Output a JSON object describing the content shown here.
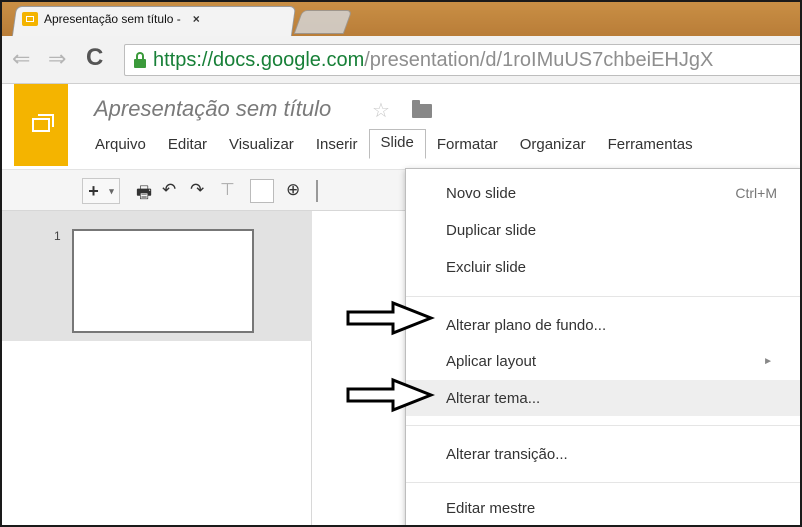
{
  "browser": {
    "tab_title": "Apresentação sem título - ",
    "tab_close": "×",
    "url_secure": "https://docs.google.com",
    "url_rest": "/presentation/d/1roIMuUS7chbeiEHJgX",
    "back_icon": "⇐",
    "forward_icon": "⇒",
    "reload_icon": "C"
  },
  "docs": {
    "title": "Apresentação sem título",
    "star_icon": "☆",
    "menus": [
      "Arquivo",
      "Editar",
      "Visualizar",
      "Inserir",
      "Slide",
      "Formatar",
      "Organizar",
      "Ferramentas"
    ]
  },
  "toolbar": {
    "new_slide_plus": "+",
    "new_slide_caret": "▾",
    "print_icon": "🖶",
    "undo_icon": "↶",
    "redo_icon": "↷",
    "paint_icon": "⊤",
    "zoom_icon": "⊕"
  },
  "filmstrip": {
    "slide_number": "1"
  },
  "slide_menu": {
    "items": [
      {
        "label": "Novo slide",
        "shortcut": "Ctrl+M"
      },
      {
        "label": "Duplicar slide"
      },
      {
        "label": "Excluir slide"
      },
      {
        "label": "Alterar plano de fundo..."
      },
      {
        "label": "Aplicar layout",
        "submenu_arrow": "►"
      },
      {
        "label": "Alterar tema..."
      },
      {
        "label": "Alterar transição..."
      },
      {
        "label": "Editar mestre"
      }
    ],
    "highlighted_item": "Alterar tema..."
  },
  "colors": {
    "brand_slides": "#f4b400",
    "tab_strip": "#c98f45",
    "secure_green": "#188038"
  }
}
